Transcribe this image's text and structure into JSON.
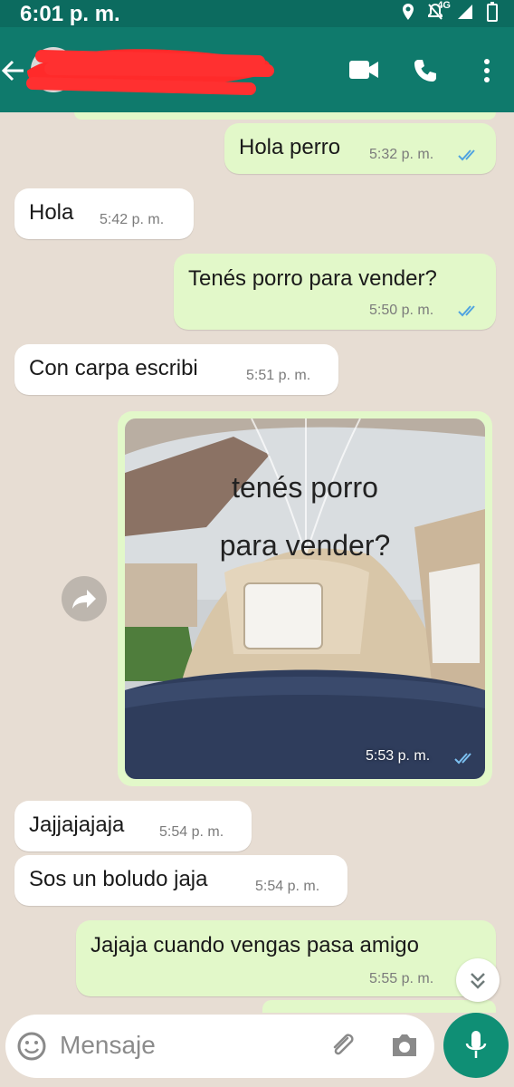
{
  "status_bar": {
    "time": "6:01 p. m.",
    "network": "4G",
    "icons": [
      "location-icon",
      "mute-icon",
      "signal-icon",
      "battery-icon"
    ]
  },
  "header": {
    "contact_name_redacted": true,
    "icons": [
      "back-arrow-icon",
      "video-call-icon",
      "phone-call-icon",
      "more-options-icon"
    ]
  },
  "messages": [
    {
      "direction": "out",
      "text": "Hola perro",
      "time": "5:32 p. m.",
      "read": true
    },
    {
      "direction": "in",
      "text": "Hola",
      "time": "5:42 p. m."
    },
    {
      "direction": "out",
      "text": "Tenés porro para vender?",
      "time": "5:50 p. m.",
      "read": true
    },
    {
      "direction": "in",
      "text": "Con carpa escribi",
      "time": "5:51 p. m."
    },
    {
      "direction": "out",
      "type": "image",
      "caption_line1": "tenés porro",
      "caption_line2": "para vender?",
      "time": "5:53 p. m.",
      "read": true
    },
    {
      "direction": "in",
      "text": "Jajjajajaja",
      "time": "5:54 p. m."
    },
    {
      "direction": "in",
      "text": "Sos un boludo jaja",
      "time": "5:54 p. m."
    },
    {
      "direction": "out",
      "text": "Jajaja cuando vengas pasa amigo",
      "time": "5:55 p. m."
    }
  ],
  "composer": {
    "placeholder": "Mensaje",
    "icons": [
      "emoji-icon",
      "attach-icon",
      "camera-icon",
      "mic-icon"
    ]
  },
  "colors": {
    "header": "#0f7a6c",
    "outgoing_bubble": "#e2f8c9",
    "incoming_bubble": "#ffffff",
    "read_ticks": "#4fa3e0",
    "mic_button": "#0f8f75"
  }
}
